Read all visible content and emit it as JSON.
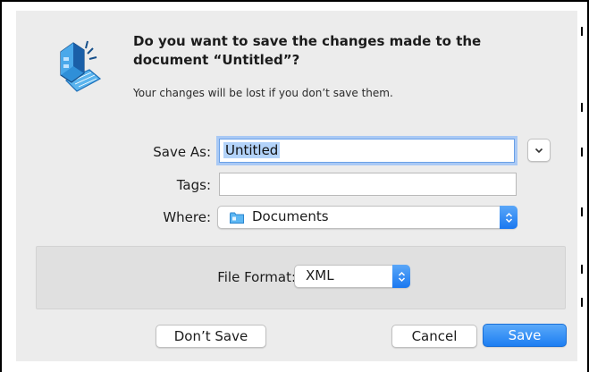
{
  "dialog": {
    "title_line1": "Do you want to save the changes made to the",
    "title_line2": "document “Untitled”?",
    "subtitle": "Your changes will be lost if you don’t save them.",
    "icon": "app-drafting-icon"
  },
  "form": {
    "save_as_label": "Save As:",
    "save_as_value": "Untitled",
    "tags_label": "Tags:",
    "tags_value": "",
    "where_label": "Where:",
    "where_value": "Documents",
    "where_icon": "folder-icon"
  },
  "format": {
    "label": "File Format:",
    "value": "XML"
  },
  "buttons": {
    "dont_save": "Don’t Save",
    "cancel": "Cancel",
    "save": "Save"
  },
  "colors": {
    "accent": "#1d7ef2",
    "focus_ring": "#a9c9f5",
    "sheet_bg": "#ececec"
  }
}
